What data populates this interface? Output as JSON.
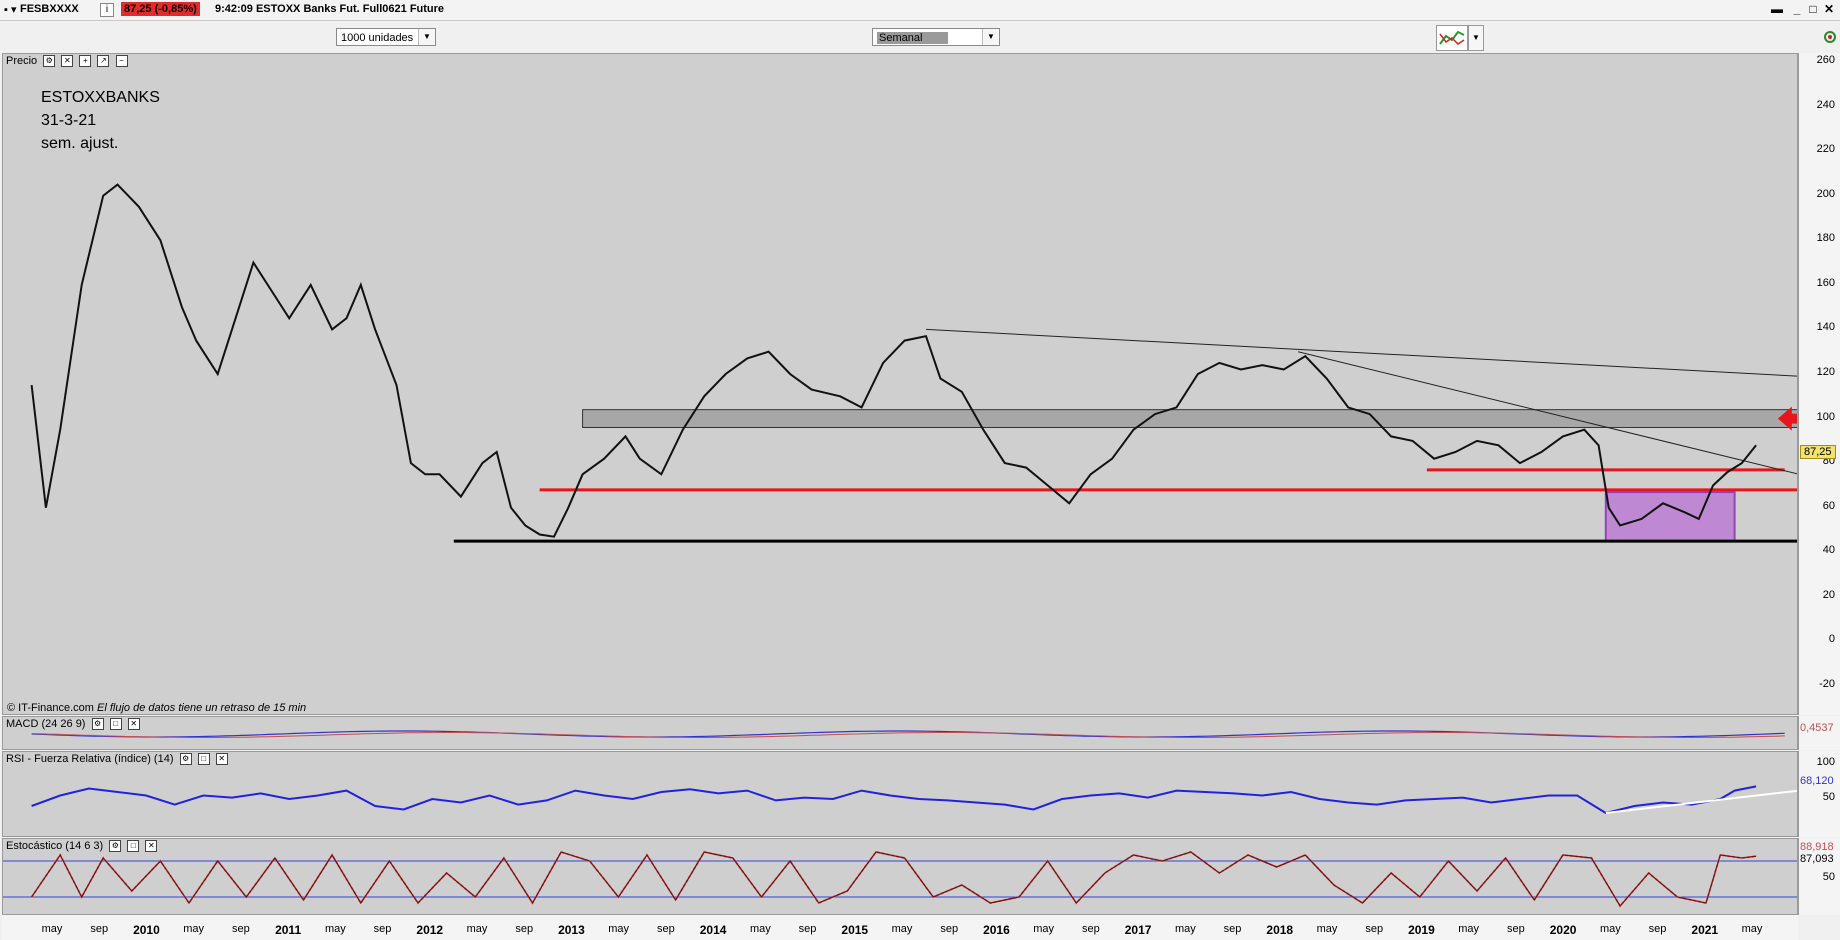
{
  "window": {
    "symbol": "FESBXXXX",
    "price_change": "87,25 (-0,85%)",
    "description": "9:42:09 ESTOXX Banks Fut. Full0621 Future"
  },
  "toolbar": {
    "units_select": "1000 unidades",
    "period_select": "Semanal"
  },
  "panels": {
    "price": {
      "label": "Precio"
    },
    "macd": {
      "label": "MACD (24 26 9)",
      "value": "0,4537"
    },
    "rsi": {
      "label": "RSI - Fuerza Relativa (índice) (14)",
      "value": "68,120"
    },
    "stoch": {
      "label": "Estocástico (14 6 3)",
      "value_a": "88,918",
      "value_b": "87,093"
    }
  },
  "annotations": {
    "line1": "ESTOXXBANKS",
    "line2": "31-3-21",
    "line3": "sem. ajust."
  },
  "credit": {
    "source": "© IT-Finance.com",
    "note": "El flujo de datos tiene un retraso de 15 min"
  },
  "colors": {
    "support_red": "#e8151b",
    "support_black": "#000000",
    "zone_gray": "#a7a7a7",
    "consolidation_purple": "#b04fd6",
    "rsi_line": "#2222dd",
    "stoch_line": "#7a1010",
    "macd_line": "#3333cc"
  },
  "chart_data": {
    "type": "line",
    "series": [
      {
        "name": "",
        "description_values": "weekly close approx"
      }
    ],
    "price_axis": {
      "ticks": [
        260,
        240,
        220,
        200,
        180,
        160,
        140,
        120,
        100,
        80,
        60,
        40,
        20,
        0,
        -20
      ],
      "ylim": [
        -20,
        260
      ]
    },
    "last_price": "87,25",
    "rsi_axis": {
      "ticks": [
        100,
        50
      ]
    },
    "stoch_axis": {
      "ticks": [
        50
      ]
    },
    "x_ticks": [
      {
        "label": "may",
        "year": false
      },
      {
        "label": "sep",
        "year": false
      },
      {
        "label": "2010",
        "year": true
      },
      {
        "label": "may",
        "year": false
      },
      {
        "label": "sep",
        "year": false
      },
      {
        "label": "2011",
        "year": true
      },
      {
        "label": "may",
        "year": false
      },
      {
        "label": "sep",
        "year": false
      },
      {
        "label": "2012",
        "year": true
      },
      {
        "label": "may",
        "year": false
      },
      {
        "label": "sep",
        "year": false
      },
      {
        "label": "2013",
        "year": true
      },
      {
        "label": "may",
        "year": false
      },
      {
        "label": "sep",
        "year": false
      },
      {
        "label": "2014",
        "year": true
      },
      {
        "label": "may",
        "year": false
      },
      {
        "label": "sep",
        "year": false
      },
      {
        "label": "2015",
        "year": true
      },
      {
        "label": "may",
        "year": false
      },
      {
        "label": "sep",
        "year": false
      },
      {
        "label": "2016",
        "year": true
      },
      {
        "label": "may",
        "year": false
      },
      {
        "label": "sep",
        "year": false
      },
      {
        "label": "2017",
        "year": true
      },
      {
        "label": "may",
        "year": false
      },
      {
        "label": "sep",
        "year": false
      },
      {
        "label": "2018",
        "year": true
      },
      {
        "label": "may",
        "year": false
      },
      {
        "label": "sep",
        "year": false
      },
      {
        "label": "2019",
        "year": true
      },
      {
        "label": "may",
        "year": false
      },
      {
        "label": "sep",
        "year": false
      },
      {
        "label": "2020",
        "year": true
      },
      {
        "label": "may",
        "year": false
      },
      {
        "label": "sep",
        "year": false
      },
      {
        "label": "2021",
        "year": true
      },
      {
        "label": "may",
        "year": false
      }
    ],
    "levels": {
      "black_support": 45,
      "red_support_1": 68,
      "red_support_2": 77,
      "gray_zone": [
        96,
        104
      ]
    },
    "price_path": [
      [
        2009.2,
        115
      ],
      [
        2009.3,
        60
      ],
      [
        2009.4,
        95
      ],
      [
        2009.55,
        160
      ],
      [
        2009.7,
        200
      ],
      [
        2009.8,
        205
      ],
      [
        2009.95,
        195
      ],
      [
        2010.1,
        180
      ],
      [
        2010.25,
        150
      ],
      [
        2010.35,
        135
      ],
      [
        2010.5,
        120
      ],
      [
        2010.6,
        140
      ],
      [
        2010.75,
        170
      ],
      [
        2010.9,
        155
      ],
      [
        2011.0,
        145
      ],
      [
        2011.15,
        160
      ],
      [
        2011.3,
        140
      ],
      [
        2011.4,
        145
      ],
      [
        2011.5,
        160
      ],
      [
        2011.6,
        140
      ],
      [
        2011.75,
        115
      ],
      [
        2011.85,
        80
      ],
      [
        2011.95,
        75
      ],
      [
        2012.05,
        75
      ],
      [
        2012.2,
        65
      ],
      [
        2012.35,
        80
      ],
      [
        2012.45,
        85
      ],
      [
        2012.55,
        60
      ],
      [
        2012.65,
        52
      ],
      [
        2012.75,
        48
      ],
      [
        2012.85,
        47
      ],
      [
        2012.95,
        60
      ],
      [
        2013.05,
        75
      ],
      [
        2013.2,
        82
      ],
      [
        2013.35,
        92
      ],
      [
        2013.45,
        82
      ],
      [
        2013.6,
        75
      ],
      [
        2013.75,
        95
      ],
      [
        2013.9,
        110
      ],
      [
        2014.05,
        120
      ],
      [
        2014.2,
        127
      ],
      [
        2014.35,
        130
      ],
      [
        2014.5,
        120
      ],
      [
        2014.65,
        113
      ],
      [
        2014.85,
        110
      ],
      [
        2015.0,
        105
      ],
      [
        2015.15,
        125
      ],
      [
        2015.3,
        135
      ],
      [
        2015.45,
        137
      ],
      [
        2015.55,
        118
      ],
      [
        2015.7,
        112
      ],
      [
        2015.85,
        95
      ],
      [
        2016.0,
        80
      ],
      [
        2016.15,
        78
      ],
      [
        2016.3,
        70
      ],
      [
        2016.45,
        62
      ],
      [
        2016.6,
        75
      ],
      [
        2016.75,
        82
      ],
      [
        2016.9,
        95
      ],
      [
        2017.05,
        102
      ],
      [
        2017.2,
        105
      ],
      [
        2017.35,
        120
      ],
      [
        2017.5,
        125
      ],
      [
        2017.65,
        122
      ],
      [
        2017.8,
        124
      ],
      [
        2017.95,
        122
      ],
      [
        2018.1,
        128
      ],
      [
        2018.25,
        118
      ],
      [
        2018.4,
        105
      ],
      [
        2018.55,
        102
      ],
      [
        2018.7,
        92
      ],
      [
        2018.85,
        90
      ],
      [
        2019.0,
        82
      ],
      [
        2019.15,
        85
      ],
      [
        2019.3,
        90
      ],
      [
        2019.45,
        88
      ],
      [
        2019.6,
        80
      ],
      [
        2019.75,
        85
      ],
      [
        2019.9,
        92
      ],
      [
        2020.05,
        95
      ],
      [
        2020.15,
        88
      ],
      [
        2020.22,
        60
      ],
      [
        2020.3,
        52
      ],
      [
        2020.45,
        55
      ],
      [
        2020.6,
        62
      ],
      [
        2020.75,
        58
      ],
      [
        2020.85,
        55
      ],
      [
        2020.95,
        70
      ],
      [
        2021.05,
        76
      ],
      [
        2021.15,
        80
      ],
      [
        2021.25,
        88
      ]
    ],
    "rsi_path": [
      [
        2009.2,
        40
      ],
      [
        2009.4,
        55
      ],
      [
        2009.6,
        65
      ],
      [
        2009.8,
        60
      ],
      [
        2010.0,
        55
      ],
      [
        2010.2,
        42
      ],
      [
        2010.4,
        55
      ],
      [
        2010.6,
        52
      ],
      [
        2010.8,
        58
      ],
      [
        2011.0,
        50
      ],
      [
        2011.2,
        55
      ],
      [
        2011.4,
        62
      ],
      [
        2011.6,
        40
      ],
      [
        2011.8,
        35
      ],
      [
        2012.0,
        50
      ],
      [
        2012.2,
        45
      ],
      [
        2012.4,
        55
      ],
      [
        2012.6,
        42
      ],
      [
        2012.8,
        48
      ],
      [
        2013.0,
        62
      ],
      [
        2013.2,
        55
      ],
      [
        2013.4,
        50
      ],
      [
        2013.6,
        60
      ],
      [
        2013.8,
        64
      ],
      [
        2014.0,
        58
      ],
      [
        2014.2,
        62
      ],
      [
        2014.4,
        48
      ],
      [
        2014.6,
        52
      ],
      [
        2014.8,
        50
      ],
      [
        2015.0,
        62
      ],
      [
        2015.2,
        55
      ],
      [
        2015.4,
        50
      ],
      [
        2015.6,
        48
      ],
      [
        2015.8,
        45
      ],
      [
        2016.0,
        42
      ],
      [
        2016.2,
        35
      ],
      [
        2016.4,
        50
      ],
      [
        2016.6,
        55
      ],
      [
        2016.8,
        58
      ],
      [
        2017.0,
        52
      ],
      [
        2017.2,
        62
      ],
      [
        2017.4,
        60
      ],
      [
        2017.6,
        58
      ],
      [
        2017.8,
        55
      ],
      [
        2018.0,
        60
      ],
      [
        2018.2,
        50
      ],
      [
        2018.4,
        45
      ],
      [
        2018.6,
        42
      ],
      [
        2018.8,
        48
      ],
      [
        2019.0,
        50
      ],
      [
        2019.2,
        52
      ],
      [
        2019.4,
        45
      ],
      [
        2019.6,
        50
      ],
      [
        2019.8,
        55
      ],
      [
        2020.0,
        55
      ],
      [
        2020.2,
        30
      ],
      [
        2020.4,
        40
      ],
      [
        2020.6,
        45
      ],
      [
        2020.8,
        42
      ],
      [
        2021.0,
        50
      ],
      [
        2021.1,
        62
      ],
      [
        2021.25,
        68
      ]
    ],
    "stoch_path": [
      [
        2009.2,
        20
      ],
      [
        2009.4,
        90
      ],
      [
        2009.55,
        20
      ],
      [
        2009.7,
        85
      ],
      [
        2009.9,
        30
      ],
      [
        2010.1,
        80
      ],
      [
        2010.3,
        10
      ],
      [
        2010.5,
        80
      ],
      [
        2010.7,
        20
      ],
      [
        2010.9,
        85
      ],
      [
        2011.1,
        15
      ],
      [
        2011.3,
        90
      ],
      [
        2011.5,
        10
      ],
      [
        2011.7,
        80
      ],
      [
        2011.9,
        10
      ],
      [
        2012.1,
        60
      ],
      [
        2012.3,
        20
      ],
      [
        2012.5,
        85
      ],
      [
        2012.7,
        10
      ],
      [
        2012.9,
        95
      ],
      [
        2013.1,
        80
      ],
      [
        2013.3,
        20
      ],
      [
        2013.5,
        90
      ],
      [
        2013.7,
        15
      ],
      [
        2013.9,
        95
      ],
      [
        2014.1,
        85
      ],
      [
        2014.3,
        20
      ],
      [
        2014.5,
        80
      ],
      [
        2014.7,
        10
      ],
      [
        2014.9,
        30
      ],
      [
        2015.1,
        95
      ],
      [
        2015.3,
        85
      ],
      [
        2015.5,
        20
      ],
      [
        2015.7,
        40
      ],
      [
        2015.9,
        10
      ],
      [
        2016.1,
        20
      ],
      [
        2016.3,
        80
      ],
      [
        2016.5,
        10
      ],
      [
        2016.7,
        60
      ],
      [
        2016.9,
        90
      ],
      [
        2017.1,
        80
      ],
      [
        2017.3,
        95
      ],
      [
        2017.5,
        60
      ],
      [
        2017.7,
        90
      ],
      [
        2017.9,
        70
      ],
      [
        2018.1,
        90
      ],
      [
        2018.3,
        40
      ],
      [
        2018.5,
        10
      ],
      [
        2018.7,
        60
      ],
      [
        2018.9,
        20
      ],
      [
        2019.1,
        80
      ],
      [
        2019.3,
        30
      ],
      [
        2019.5,
        85
      ],
      [
        2019.7,
        15
      ],
      [
        2019.9,
        90
      ],
      [
        2020.1,
        85
      ],
      [
        2020.3,
        5
      ],
      [
        2020.5,
        60
      ],
      [
        2020.7,
        20
      ],
      [
        2020.9,
        10
      ],
      [
        2021.0,
        90
      ],
      [
        2021.15,
        85
      ],
      [
        2021.25,
        88
      ]
    ]
  }
}
